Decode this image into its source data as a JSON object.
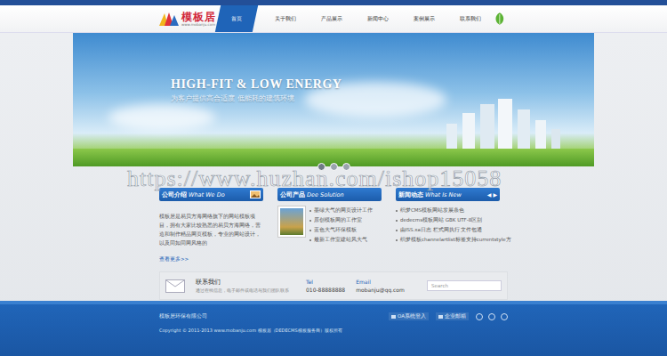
{
  "logo": {
    "name": "模板居",
    "url": "www.mobanju.com"
  },
  "nav": [
    {
      "label": "首页",
      "selected": true
    },
    {
      "label": "关于我们",
      "selected": false
    },
    {
      "label": "产品展示",
      "selected": false
    },
    {
      "label": "新闻中心",
      "selected": false
    },
    {
      "label": "案例展示",
      "selected": false
    },
    {
      "label": "联系我们",
      "selected": false
    }
  ],
  "banner": {
    "title": "HIGH-FIT & LOW ENERGY",
    "subtitle": "为客户提供高合适度 低能耗的建筑环境"
  },
  "slider_dots": [
    {
      "selected": true
    },
    {
      "selected": false
    },
    {
      "selected": false
    }
  ],
  "watermark": "https://www.huzhan.com/ishop15058",
  "sections": [
    {
      "kind": "text",
      "title": "公司介绍",
      "subtitle": "What We Do",
      "arrows": [],
      "text": "模板居是易贝方海网络旗下的网站模板项目，拥有大家比较熟悉的易贝方海网络，营造和制作精品网页模板，专业的网站设计，以及同如同网风格的",
      "more": "查看更多>>",
      "items": []
    },
    {
      "kind": "products",
      "title": "公司产品",
      "subtitle": "Dee Solution",
      "arrows": [],
      "text": "",
      "more": "",
      "items": [
        "墨绿大气的网页设计工作",
        "原创模板网的工作室",
        "蓝色大气环保模板",
        "最新工作室建站风大气"
      ]
    },
    {
      "kind": "news",
      "title": "新闻动态",
      "subtitle": "What Is New",
      "arrows": [
        "◀",
        "▶"
      ],
      "text": "",
      "more": "",
      "items": [
        "织梦CMS模板网站发展条色",
        "dedecms模板网站 GBK UTF-8区别",
        "由ISS.xa日志 栏式网执行 文件包通",
        "织梦模板channelartlist标签支持currentstyle方"
      ]
    }
  ],
  "contact": {
    "title": "联系我们",
    "desc": "通过在线信息，电子邮件或电话与我们团队联系",
    "tel_label": "Tel",
    "tel": "010-88888888",
    "email_label": "Email",
    "email": "mobanju@qq.com",
    "search_placeholder": "Search"
  },
  "footer": {
    "company": "模板居环保有限公司",
    "links": [
      "OA系统登入",
      "企业邮箱"
    ],
    "copyright": "Copyright © 2011-2013 www.mobanju.com 模板居（DEDECMS模板服务商）版权所有"
  }
}
